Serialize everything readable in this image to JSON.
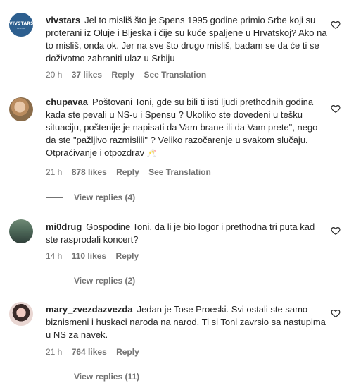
{
  "comments": [
    {
      "username": "vivstars",
      "avatar_text": "VIVSTARS",
      "avatar_sub": "DIGITAL",
      "text": "Jel to misliš što je Spens 1995 godine primio Srbe koji su proterani iz Oluje i Bljeska i čije su kuće spaljene u Hrvatskoj? Ako na to misliš, onda ok. Jer na sve što drugo misliš, badam se da će ti se doživotno zabraniti ulaz u Srbiju",
      "time": "20 h",
      "likes": "37 likes",
      "reply": "Reply",
      "translate": "See Translation"
    },
    {
      "username": "chupavaa",
      "text": "Poštovani Toni, gde su bili ti isti ljudi prethodnih godina kada ste pevali u NS-u i Spensu ? Ukoliko ste dovedeni u tešku situaciju, poštenije je napisati da Vam brane ili da Vam prete\", nego da ste \"pažljivo razmislili\" ? Veliko razočarenje u svakom slučaju. Otpraćivanje i otpozdrav",
      "emoji": "🥂",
      "time": "21 h",
      "likes": "878 likes",
      "reply": "Reply",
      "translate": "See Translation",
      "view_replies": "View replies (4)"
    },
    {
      "username": "mi0drug",
      "text": "Gospodine Toni, da li je bio logor i prethodna tri puta kad ste rasprodali koncert?",
      "time": "14 h",
      "likes": "110 likes",
      "reply": "Reply",
      "view_replies": "View replies (2)"
    },
    {
      "username": "mary_zvezdazvezda",
      "text": "Jedan je Tose Proeski. Svi ostali ste samo biznismeni i huskaci naroda na narod. Ti si Toni zavrsio sa nastupima u NS za navek.",
      "time": "21 h",
      "likes": "764 likes",
      "reply": "Reply",
      "view_replies": "View replies (11)"
    }
  ],
  "icons": {
    "like": "heart-outline-icon"
  },
  "colors": {
    "text": "#262626",
    "meta": "#737373",
    "avatar_vivstars": "#2d5f8f"
  }
}
